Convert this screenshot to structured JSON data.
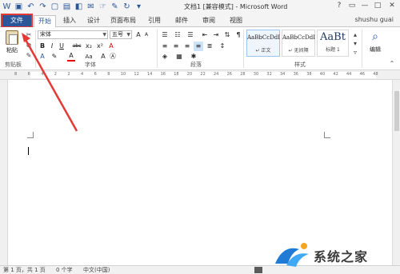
{
  "titlebar": {
    "title": "文档1 [兼容模式] - Microsoft Word",
    "controls": [
      "?",
      "▭",
      "—",
      "□",
      "✕"
    ]
  },
  "tabs": [
    {
      "label": "文件"
    },
    {
      "label": "开始"
    },
    {
      "label": "插入"
    },
    {
      "label": "设计"
    },
    {
      "label": "页面布局"
    },
    {
      "label": "引用"
    },
    {
      "label": "邮件"
    },
    {
      "label": "审阅"
    },
    {
      "label": "视图"
    }
  ],
  "user": "shushu guai",
  "ribbon": {
    "clipboard": {
      "paste": "粘贴",
      "group": "剪贴板"
    },
    "font": {
      "name": "宋体",
      "size": "五号",
      "bold": "B",
      "italic": "I",
      "underline": "U",
      "strike": "abc",
      "subscript": "x₂",
      "superscript": "x²",
      "font_color": "A",
      "change_case": "Aa",
      "grow": "A",
      "shrink": "A",
      "clear": "A",
      "group": "字体"
    },
    "paragraph": {
      "group": "段落"
    },
    "styles": {
      "items": [
        {
          "preview": "AaBbCcDdI",
          "name": "↵ 正文"
        },
        {
          "preview": "AaBbCcDdI",
          "name": "↵ 无间隔"
        },
        {
          "preview": "AaBt",
          "name": "标题 1"
        }
      ],
      "group": "样式"
    },
    "editing": {
      "label": "编辑"
    }
  },
  "ruler": {
    "numbers": [
      "8",
      "6",
      "4",
      "2",
      "2",
      "4",
      "6",
      "8",
      "10",
      "12",
      "14",
      "16",
      "18",
      "20",
      "22",
      "24",
      "26",
      "28",
      "30",
      "32",
      "34",
      "36",
      "38",
      "40",
      "42",
      "44",
      "46",
      "48"
    ]
  },
  "status": {
    "page": "第 1 页，共 1 页",
    "words": "0 个字",
    "language": "中文(中国)"
  },
  "watermark": {
    "text": "系统之家"
  },
  "colors": {
    "accent": "#2b579a",
    "arrow": "#e53935"
  }
}
